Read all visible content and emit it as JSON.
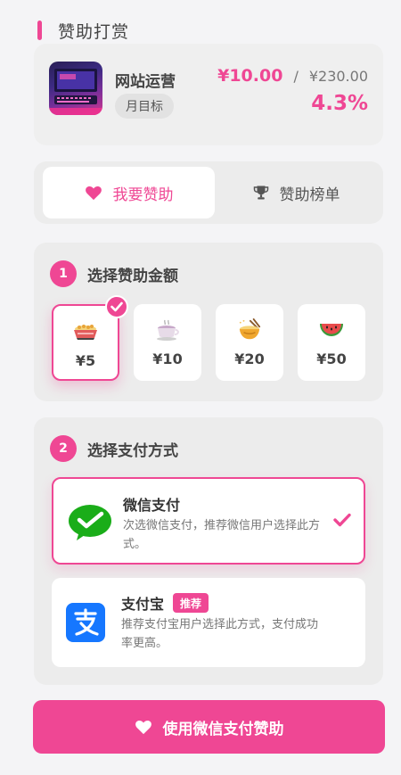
{
  "header": {
    "title": "赞助打赏"
  },
  "project": {
    "name": "网站运营",
    "tag": "月目标",
    "current": "¥10.00",
    "separator": "/",
    "goal": "¥230.00",
    "percent": "4.3%",
    "progress_fraction": 0.043
  },
  "tabs": [
    {
      "label": "我要赞助",
      "icon": "heart-icon",
      "active": true
    },
    {
      "label": "赞助榜单",
      "icon": "trophy-icon",
      "active": false
    }
  ],
  "amount_section": {
    "step": "1",
    "title": "选择赞助金额",
    "options": [
      {
        "label": "¥5",
        "icon": "snack-bowl-icon",
        "selected": true
      },
      {
        "label": "¥10",
        "icon": "tea-cup-icon",
        "selected": false
      },
      {
        "label": "¥20",
        "icon": "noodle-bowl-icon",
        "selected": false
      },
      {
        "label": "¥50",
        "icon": "watermelon-icon",
        "selected": false
      }
    ]
  },
  "payment_section": {
    "step": "2",
    "title": "选择支付方式",
    "methods": [
      {
        "name": "微信支付",
        "description": "次选微信支付，推荐微信用户选择此方式。",
        "selected": true,
        "icon": "wechat-pay-icon"
      },
      {
        "name": "支付宝",
        "badge": "推荐",
        "description": "推荐支付宝用户选择此方式，支付成功率更高。",
        "selected": false,
        "icon": "alipay-icon"
      }
    ]
  },
  "submit": {
    "label": "使用微信支付赞助",
    "icon": "heart-icon"
  },
  "colors": {
    "accent": "#ef4794",
    "wechat": "#1aad19",
    "alipay": "#1677ff"
  }
}
